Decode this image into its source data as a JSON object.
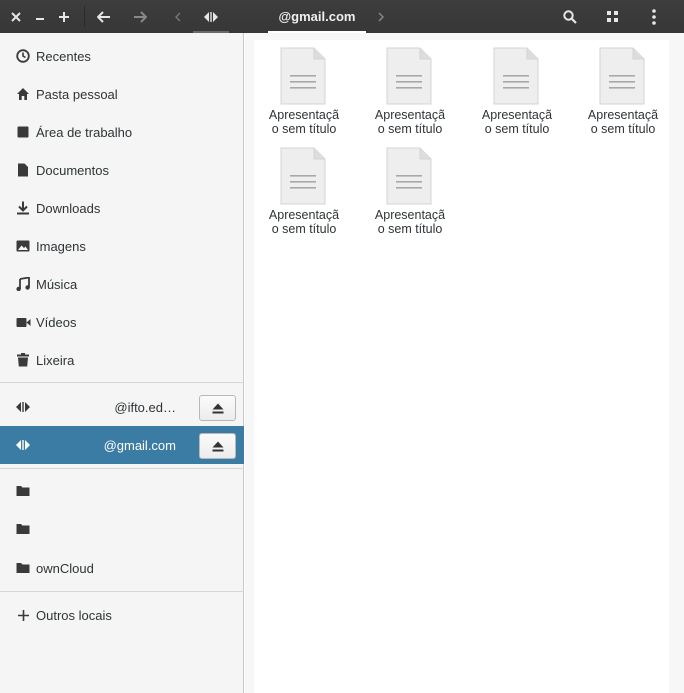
{
  "header": {
    "close_icon": "close-icon",
    "minimize_icon": "minimize-icon",
    "new_tab_icon": "plus-icon",
    "back_icon": "arrow-left-icon",
    "forward_icon": "arrow-right-icon",
    "path_prev_icon": "chevron-left-icon",
    "path_root_icon": "network-drive-icon",
    "path_current": "@gmail.com",
    "path_next_icon": "chevron-right-icon",
    "search_icon": "search-icon",
    "view_icon": "grid-view-icon",
    "menu_icon": "kebab-menu-icon"
  },
  "sidebar": {
    "places": [
      {
        "label": "Recentes",
        "icon": "clock-icon"
      },
      {
        "label": "Pasta pessoal",
        "icon": "home-icon"
      },
      {
        "label": "Área de trabalho",
        "icon": "desktop-icon"
      },
      {
        "label": "Documentos",
        "icon": "document-icon"
      },
      {
        "label": "Downloads",
        "icon": "download-icon"
      },
      {
        "label": "Imagens",
        "icon": "image-icon"
      },
      {
        "label": "Música",
        "icon": "music-icon"
      },
      {
        "label": "Vídeos",
        "icon": "video-icon"
      },
      {
        "label": "Lixeira",
        "icon": "trash-icon"
      }
    ],
    "mounts": [
      {
        "label": "@ifto.ed…",
        "icon": "network-drive-icon",
        "selected": false
      },
      {
        "label": "@gmail.com",
        "icon": "network-drive-icon",
        "selected": true
      }
    ],
    "bookmarks": [
      {
        "label": "",
        "icon": "folder-icon"
      },
      {
        "label": "",
        "icon": "folder-icon"
      },
      {
        "label": "ownCloud",
        "icon": "folder-icon"
      }
    ],
    "other_locations": {
      "label": "Outros locais",
      "icon": "plus-icon"
    }
  },
  "files": [
    {
      "name_line1": "Apresentaçã",
      "name_line2": "o sem título"
    },
    {
      "name_line1": "Apresentaçã",
      "name_line2": "o sem título"
    },
    {
      "name_line1": "Apresentaçã",
      "name_line2": "o sem título"
    },
    {
      "name_line1": "Apresentaçã",
      "name_line2": "o sem título"
    },
    {
      "name_line1": "Apresentaçã",
      "name_line2": "o sem título"
    },
    {
      "name_line1": "Apresentaçã",
      "name_line2": "o sem título"
    }
  ],
  "colors": {
    "header_bg": "#3b3b3b",
    "sidebar_bg": "#f5f5f5",
    "selected_bg": "#3b7ca4"
  }
}
